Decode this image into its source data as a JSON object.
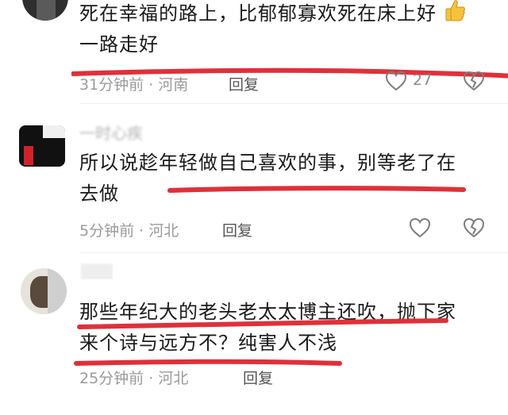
{
  "comments": [
    {
      "lines": [
        "死在幸福的路上，比郁郁寡欢死在床上好",
        "一路走好"
      ],
      "meta": "31分钟前 · 河南",
      "reply": "回复",
      "likes": "27",
      "has_emoji": true
    },
    {
      "username": "一时心疾",
      "lines": [
        "所以说趁年轻做自己喜欢的事，别等老了在",
        "去做"
      ],
      "meta": "5分钟前 · 河北",
      "reply": "回复"
    },
    {
      "lines": [
        "那些年纪大的老头老太太博主还吹，抛下家",
        "来个诗与远方不？纯害人不浅"
      ],
      "meta": "25分钟前 · 河北",
      "reply": "回复"
    }
  ],
  "colors": {
    "annotation_red": "#e0303a",
    "meta_gray": "#9a9a9a",
    "text_dark": "#1a1a1a"
  },
  "icons": [
    "heart-outline-icon",
    "broken-heart-icon",
    "thumbs-up-emoji"
  ]
}
